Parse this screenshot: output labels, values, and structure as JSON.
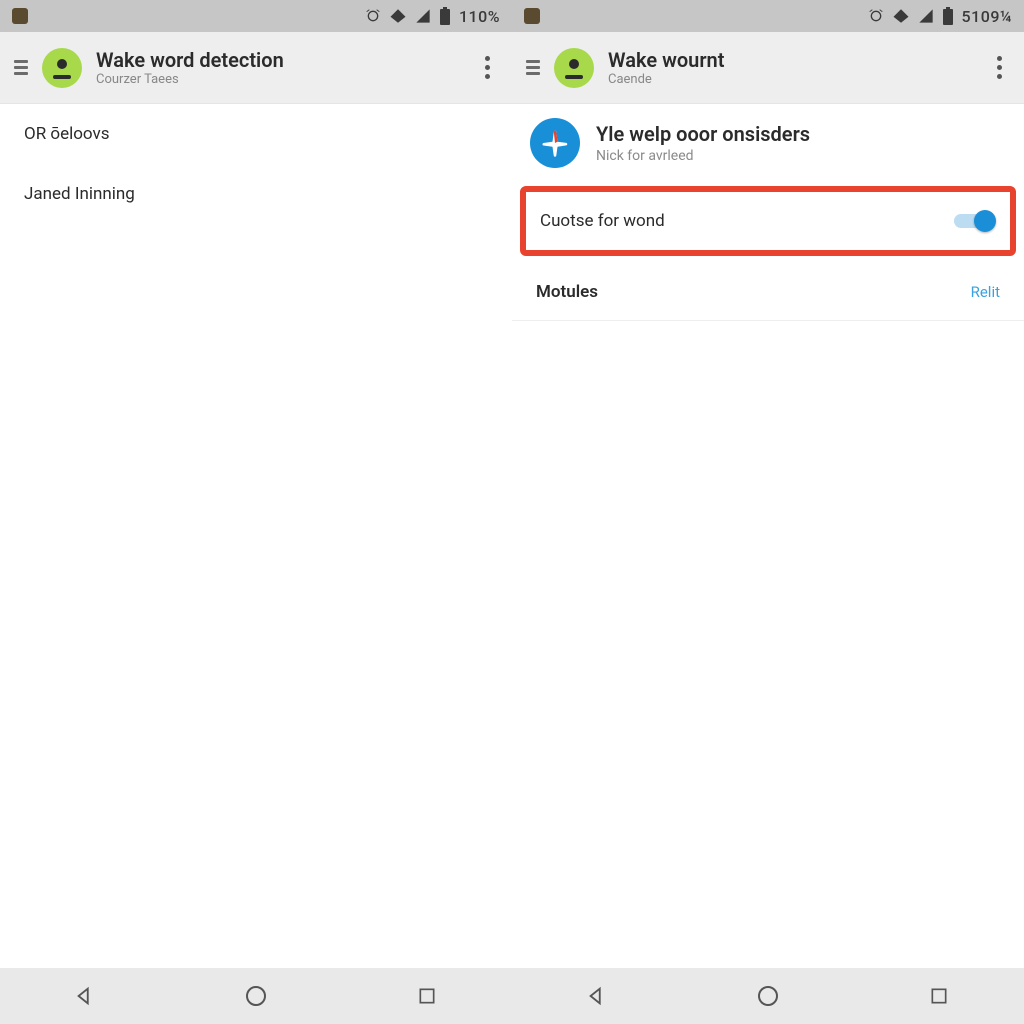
{
  "left": {
    "status": {
      "time": "110%"
    },
    "appbar": {
      "title": "Wake word detection",
      "subtitle": "Courzer Taees"
    },
    "rows": [
      {
        "text": "OR ōeloovs"
      },
      {
        "text": "Janed Ininning"
      }
    ]
  },
  "right": {
    "status": {
      "time": "5109¼"
    },
    "appbar": {
      "title": "Wake wournt",
      "subtitle": "Caende"
    },
    "card": {
      "title": "Yle welp ooor onsisders",
      "subtitle": "Nick for avrleed"
    },
    "toggle_row": {
      "label": "Cuotse for wond",
      "on": true
    },
    "section": {
      "title": "Motules",
      "action": "Relit"
    }
  }
}
